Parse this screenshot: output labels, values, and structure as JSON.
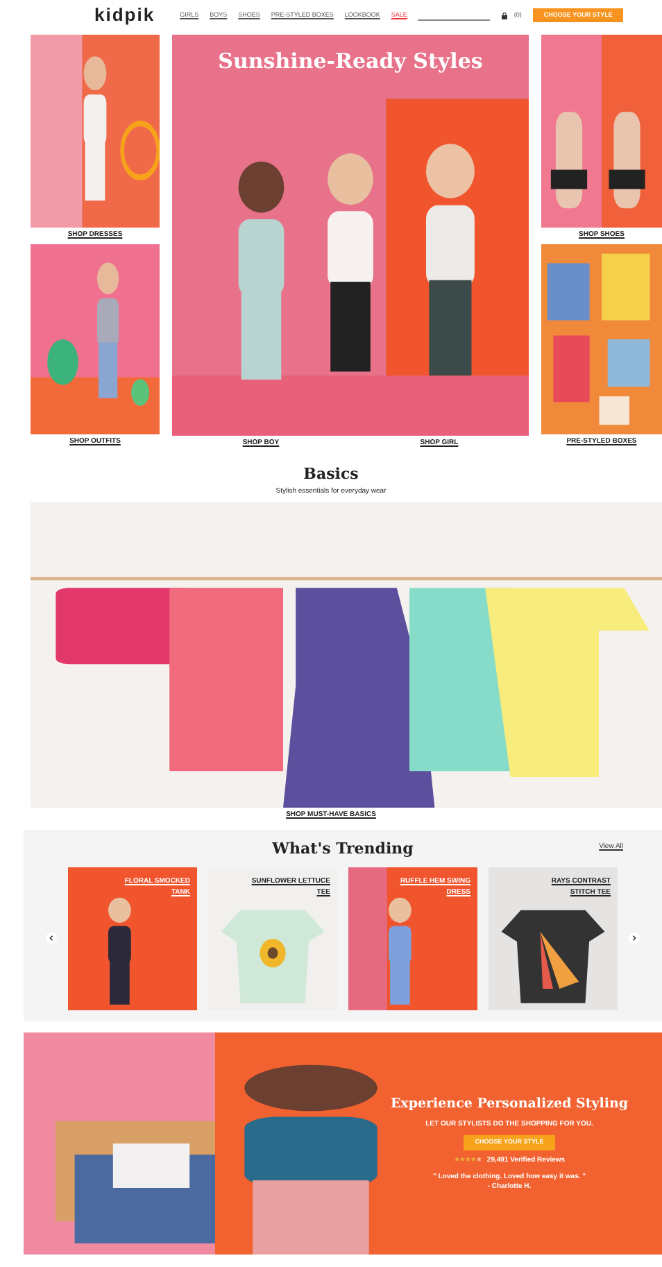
{
  "header": {
    "logo": "kidpik",
    "nav": [
      {
        "label": "GIRLS",
        "kind": "link"
      },
      {
        "label": "BOYS",
        "kind": "link"
      },
      {
        "label": "SHOES",
        "kind": "link"
      },
      {
        "label": "PRE-STYLED BOXES",
        "kind": "link"
      },
      {
        "label": "LOOKBOOK",
        "kind": "link"
      },
      {
        "label": "SALE",
        "kind": "sale"
      }
    ],
    "cart_count": "(0)",
    "button": "CHOOSE YOUR STYLE"
  },
  "hero": {
    "left": [
      {
        "label": "SHOP DRESSES"
      },
      {
        "label": "SHOP OUTFITS"
      }
    ],
    "center": {
      "title": "Sunshine-Ready Styles",
      "links": [
        "SHOP BOY",
        "SHOP GIRL"
      ]
    },
    "right": [
      {
        "label": "SHOP SHOES"
      },
      {
        "label": "PRE-STYLED BOXES"
      }
    ]
  },
  "basics": {
    "title": "Basics",
    "subtitle": "Stylish essentials for everyday wear",
    "link": "SHOP MUST-HAVE BASICS"
  },
  "trending": {
    "title": "What's Trending",
    "view_all": "View All",
    "items": [
      {
        "name": "FLORAL SMOCKED TANK"
      },
      {
        "name": "SUNFLOWER LETTUCE TEE"
      },
      {
        "name": "RUFFLE HEM SWING DRESS"
      },
      {
        "name": "RAYS CONTRAST STITCH TEE"
      }
    ]
  },
  "banner": {
    "title": "Experience Personalized Styling",
    "subtitle": "LET OUR STYLISTS DO THE SHOPPING FOR YOU.",
    "button": "CHOOSE YOUR STYLE",
    "stars": 4,
    "reviews": "29,491 Verified Reviews",
    "quote": "\" Loved the clothing. Loved how easy it was. \"",
    "author": "- Charlotte H."
  }
}
